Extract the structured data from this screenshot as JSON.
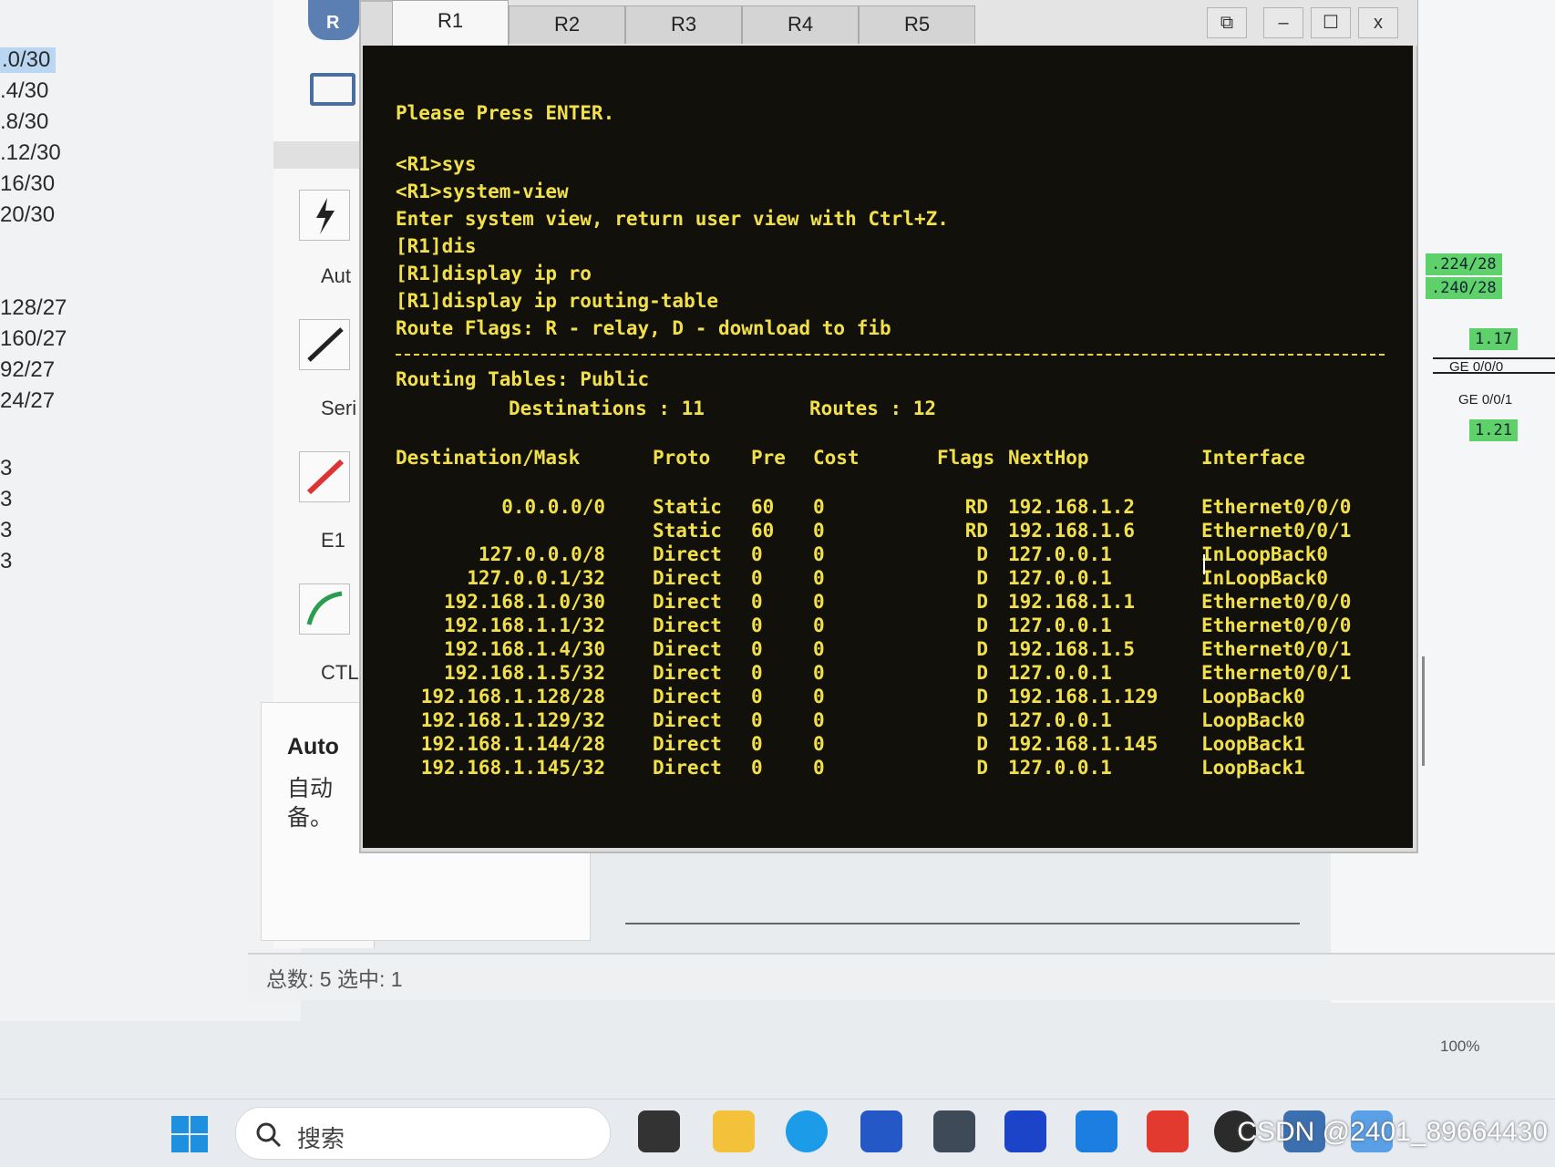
{
  "left_notes": {
    "items": [
      ".0/30",
      ".4/30",
      ".8/30",
      ".12/30",
      "16/30",
      "20/30",
      "128/27",
      "160/27",
      "92/27",
      "24/27",
      "3",
      "3",
      "3",
      "3"
    ]
  },
  "palette": {
    "labels": [
      "Aut",
      "Seri",
      "E1",
      "CTL"
    ]
  },
  "info_panel": {
    "title": "Auto",
    "desc_line1": "自动",
    "desc_line2": "备。"
  },
  "status_bar": {
    "text": "总数: 5 选中: 1"
  },
  "topology": {
    "tag1": ".224/28",
    "tag2": ".240/28",
    "tag3": "1.17",
    "tag4": "1.21",
    "port1": "GE 0/0/0",
    "port2": "GE 0/0/1"
  },
  "window": {
    "tabs": [
      "R1",
      "R2",
      "R3",
      "R4",
      "R5"
    ],
    "active_tab": "R1",
    "buttons": {
      "restore": "⧉",
      "minimize": "–",
      "maximize": "☐",
      "close": "x"
    }
  },
  "terminal": {
    "lines": [
      "Please Press ENTER.",
      "<R1>sys",
      "<R1>system-view",
      "Enter system view, return user view with Ctrl+Z.",
      "[R1]dis",
      "[R1]display ip ro",
      "[R1]display ip routing-table",
      "Route Flags: R - relay, D - download to fib"
    ],
    "table_title": "Routing Tables: Public",
    "destinations_label": "Destinations : 11",
    "routes_label": "Routes : 12",
    "headers": {
      "dest": "Destination/Mask",
      "proto": "Proto",
      "pre": "Pre",
      "cost": "Cost",
      "flags": "Flags",
      "nexthop": "NextHop",
      "iface": "Interface"
    },
    "rows": [
      {
        "dest": "0.0.0.0/0",
        "proto": "Static",
        "pre": "60",
        "cost": "0",
        "flags": "RD",
        "nexthop": "192.168.1.2",
        "iface": "Ethernet0/0/0"
      },
      {
        "dest": "",
        "proto": "Static",
        "pre": "60",
        "cost": "0",
        "flags": "RD",
        "nexthop": "192.168.1.6",
        "iface": "Ethernet0/0/1"
      },
      {
        "dest": "127.0.0.0/8",
        "proto": "Direct",
        "pre": "0",
        "cost": "0",
        "flags": "D",
        "nexthop": "127.0.0.1",
        "iface": "InLoopBack0"
      },
      {
        "dest": "127.0.0.1/32",
        "proto": "Direct",
        "pre": "0",
        "cost": "0",
        "flags": "D",
        "nexthop": "127.0.0.1",
        "iface": "InLoopBack0"
      },
      {
        "dest": "192.168.1.0/30",
        "proto": "Direct",
        "pre": "0",
        "cost": "0",
        "flags": "D",
        "nexthop": "192.168.1.1",
        "iface": "Ethernet0/0/0"
      },
      {
        "dest": "192.168.1.1/32",
        "proto": "Direct",
        "pre": "0",
        "cost": "0",
        "flags": "D",
        "nexthop": "127.0.0.1",
        "iface": "Ethernet0/0/0"
      },
      {
        "dest": "192.168.1.4/30",
        "proto": "Direct",
        "pre": "0",
        "cost": "0",
        "flags": "D",
        "nexthop": "192.168.1.5",
        "iface": "Ethernet0/0/1"
      },
      {
        "dest": "192.168.1.5/32",
        "proto": "Direct",
        "pre": "0",
        "cost": "0",
        "flags": "D",
        "nexthop": "127.0.0.1",
        "iface": "Ethernet0/0/1"
      },
      {
        "dest": "192.168.1.128/28",
        "proto": "Direct",
        "pre": "0",
        "cost": "0",
        "flags": "D",
        "nexthop": "192.168.1.129",
        "iface": "LoopBack0"
      },
      {
        "dest": "192.168.1.129/32",
        "proto": "Direct",
        "pre": "0",
        "cost": "0",
        "flags": "D",
        "nexthop": "127.0.0.1",
        "iface": "LoopBack0"
      },
      {
        "dest": "192.168.1.144/28",
        "proto": "Direct",
        "pre": "0",
        "cost": "0",
        "flags": "D",
        "nexthop": "192.168.1.145",
        "iface": "LoopBack1"
      },
      {
        "dest": "192.168.1.145/32",
        "proto": "Direct",
        "pre": "0",
        "cost": "0",
        "flags": "D",
        "nexthop": "127.0.0.1",
        "iface": "LoopBack1"
      }
    ]
  },
  "taskbar": {
    "search_placeholder": "搜索",
    "zoom": "100%",
    "watermark": "CSDN @2401_89664430",
    "icons": [
      "windows-start-icon",
      "search-icon",
      "task-view-icon",
      "file-explorer-icon",
      "edge-icon",
      "store-icon",
      "ensp-icon",
      "app-icon-blue",
      "app-icon-arrow",
      "wps-icon",
      "qq-icon",
      "python-icon",
      "notepad-icon"
    ]
  }
}
